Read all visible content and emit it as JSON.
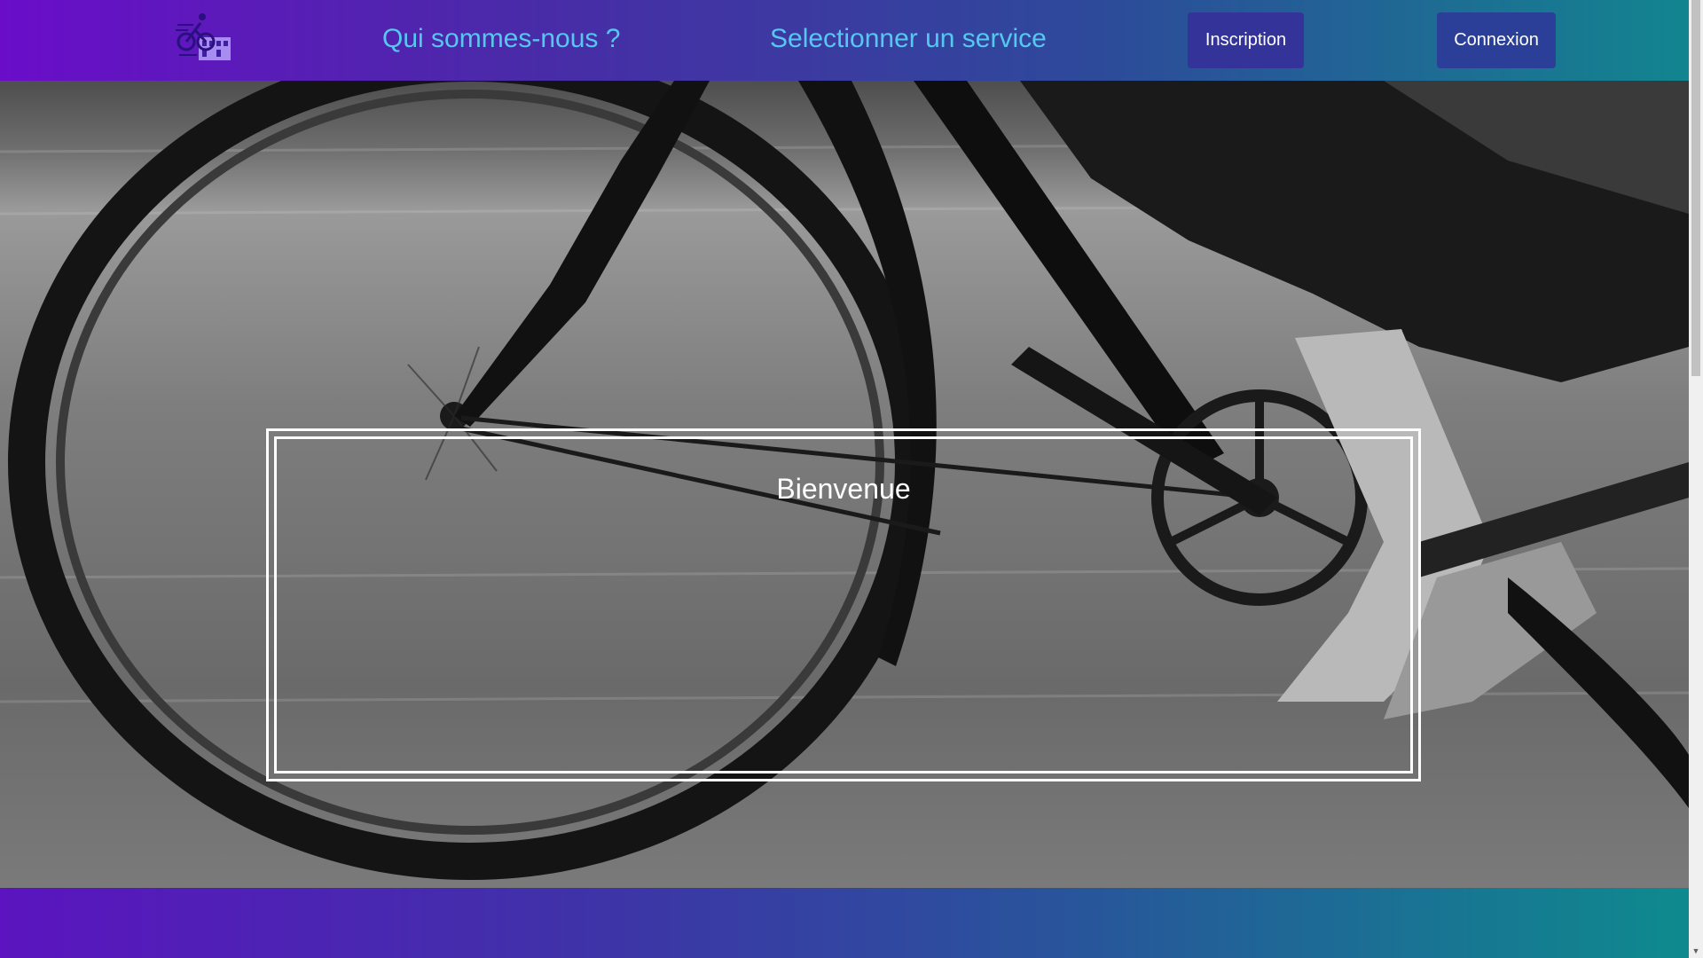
{
  "header": {
    "logo_icon": "cyclist-delivery-icon",
    "nav": {
      "about": "Qui sommes-nous ?",
      "service": "Selectionner un service"
    },
    "buttons": {
      "register": "Inscription",
      "login": "Connexion"
    }
  },
  "hero": {
    "image": "bicycle-wheel-photo",
    "welcome": "Bienvenue"
  },
  "colors": {
    "header_gradient_start": "#6a0dc9",
    "header_gradient_end": "#12858f",
    "nav_link": "#56c8f0",
    "button_bg": "#33339a"
  }
}
